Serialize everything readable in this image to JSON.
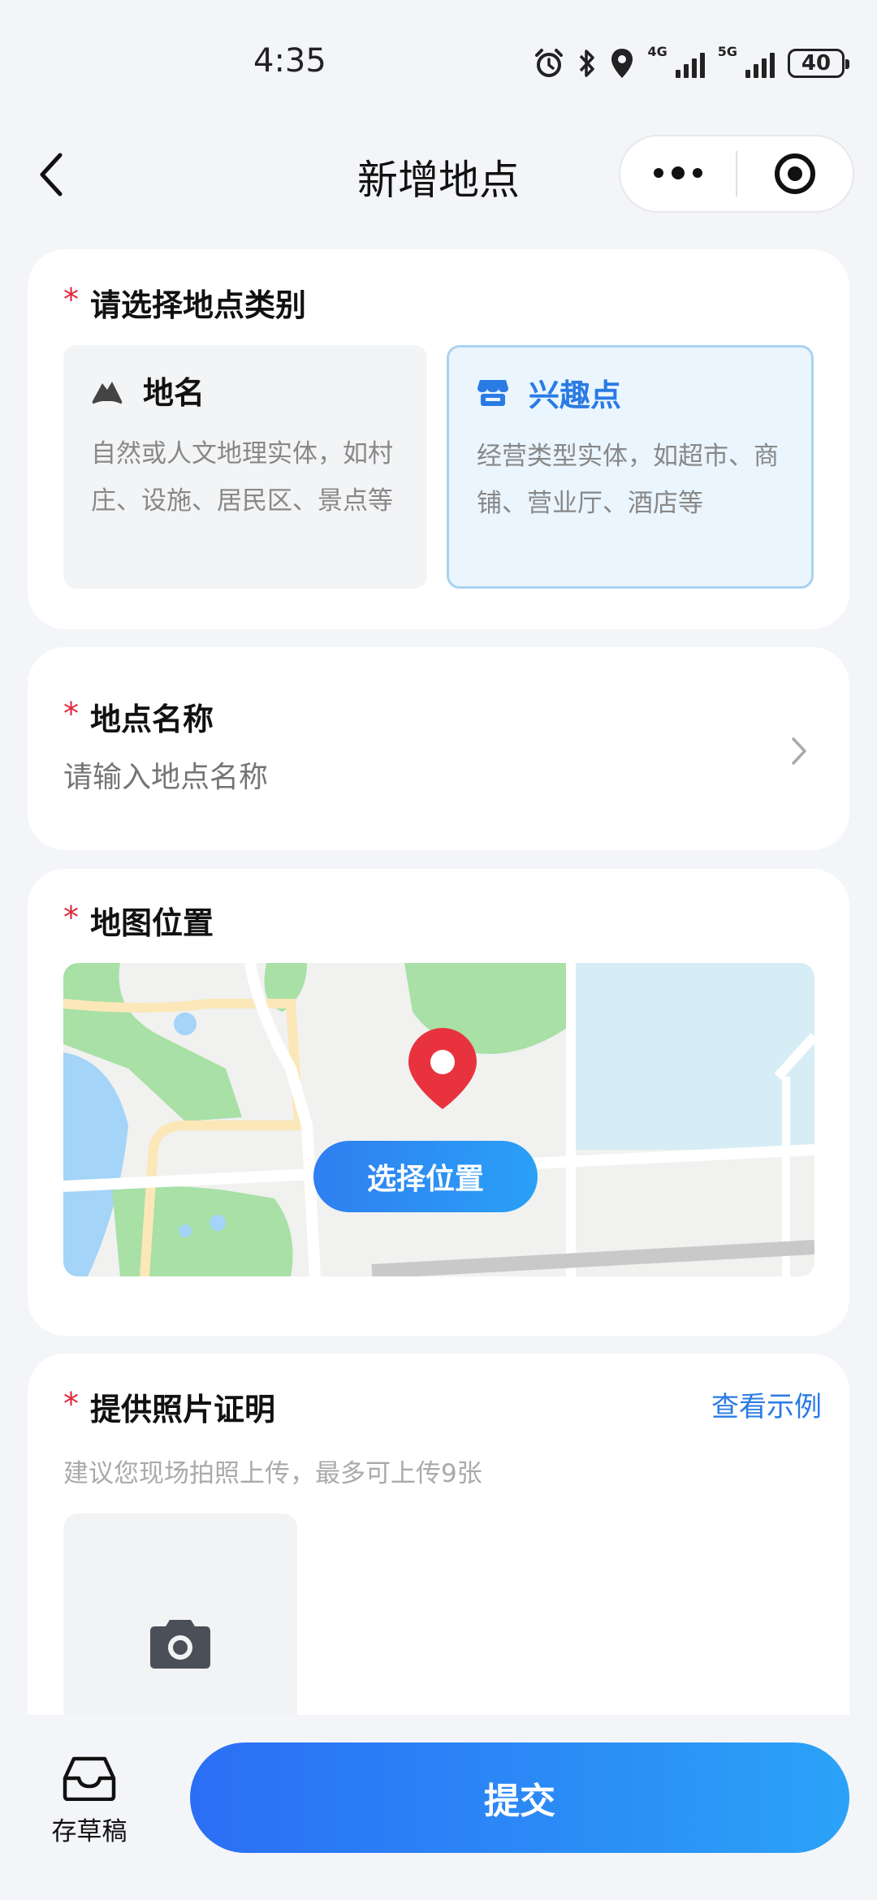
{
  "status_bar": {
    "time": "4:35",
    "battery": "40",
    "net1": "4G",
    "net2": "5G"
  },
  "nav": {
    "title": "新增地点"
  },
  "category": {
    "label": "请选择地点类别",
    "required_mark": "*",
    "options": [
      {
        "title": "地名",
        "desc": "自然或人文地理实体，如村庄、设施、居民区、景点等",
        "icon": "mountain-icon",
        "selected": false
      },
      {
        "title": "兴趣点",
        "desc": "经营类型实体，如超市、商铺、营业厅、酒店等",
        "icon": "shop-icon",
        "selected": true
      }
    ]
  },
  "name_field": {
    "label": "地点名称",
    "required_mark": "*",
    "placeholder": "请输入地点名称"
  },
  "map_field": {
    "label": "地图位置",
    "required_mark": "*",
    "button": "选择位置"
  },
  "photo_field": {
    "label": "提供照片证明",
    "required_mark": "*",
    "example_link": "查看示例",
    "hint": "建议您现场拍照上传，最多可上传9张"
  },
  "bottom": {
    "draft_label": "存草稿",
    "submit_label": "提交"
  },
  "colors": {
    "accent": "#2a7be4",
    "required": "#e0263d",
    "selected_bg": "#eaf5fe"
  }
}
